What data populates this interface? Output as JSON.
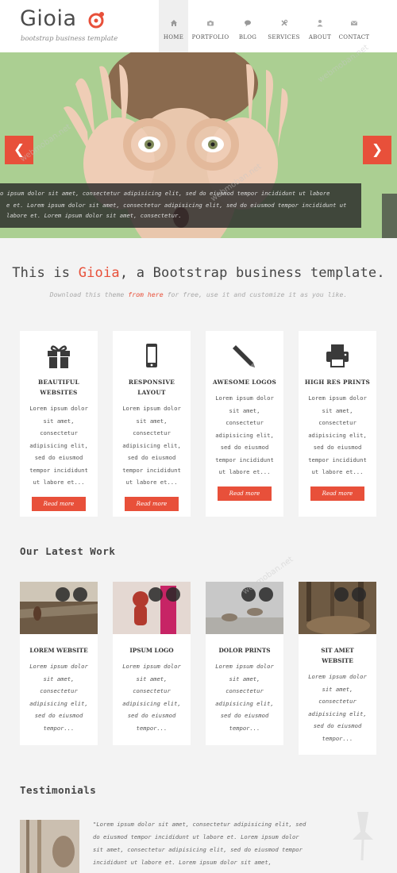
{
  "brand": {
    "name": "Gioia",
    "tagline": "bootstrap business template"
  },
  "nav": {
    "items": [
      {
        "label": "HOME",
        "icon": "home-icon"
      },
      {
        "label": "PORTFOLIO",
        "icon": "camera-icon"
      },
      {
        "label": "BLOG",
        "icon": "comment-icon"
      },
      {
        "label": "SERVICES",
        "icon": "wrench-icon"
      },
      {
        "label": "ABOUT",
        "icon": "user-icon"
      },
      {
        "label": "CONTACT",
        "icon": "envelope-icon"
      }
    ],
    "active": "HOME"
  },
  "hero": {
    "caption_lines": [
      "o ipsum dolor sit amet, consectetur adipisicing elit, sed do eiusmod tempor incididunt ut labore",
      "e et. Lorem ipsum dolor sit amet, consectetur adipisicing elit, sed do eiusmod tempor incididunt ut",
      "labore et. Lorem ipsum dolor sit amet, consectetur."
    ],
    "prev_icon": "chevron-left-icon",
    "next_icon": "chevron-right-icon"
  },
  "intro": {
    "title_pre": "This is ",
    "title_brand": "Gioia",
    "title_post": ", a Bootstrap business template.",
    "sub_pre": "Download this theme ",
    "sub_link": "from here",
    "sub_post": " for free, use it and customize it as you like."
  },
  "features": [
    {
      "icon": "gift-icon",
      "title_lines": [
        "BEAUTIFUL",
        "WEBSITES"
      ],
      "text_lines": [
        "Lorem ipsum dolor",
        "sit amet,",
        "consectetur",
        "adipisicing elit,",
        "sed do eiusmod",
        "tempor incididunt",
        "ut labore et..."
      ],
      "button": "Read more"
    },
    {
      "icon": "mobile-icon",
      "title_lines": [
        "RESPONSIVE",
        "LAYOUT"
      ],
      "text_lines": [
        "Lorem ipsum dolor",
        "sit amet,",
        "consectetur",
        "adipisicing elit,",
        "sed do eiusmod",
        "tempor incididunt",
        "ut labore et..."
      ],
      "button": "Read more"
    },
    {
      "icon": "pencil-icon",
      "title_lines": [
        "AWESOME LOGOS"
      ],
      "text_lines": [
        "Lorem ipsum dolor",
        "sit amet,",
        "consectetur",
        "adipisicing elit,",
        "sed do eiusmod",
        "tempor incididunt",
        "ut labore et..."
      ],
      "button": "Read more"
    },
    {
      "icon": "print-icon",
      "title_lines": [
        "HIGH RES PRINTS"
      ],
      "text_lines": [
        "Lorem ipsum dolor",
        "sit amet,",
        "consectetur",
        "adipisicing elit,",
        "sed do eiusmod",
        "tempor incididunt",
        "ut labore et..."
      ],
      "button": "Read more"
    }
  ],
  "latest_work": {
    "heading": "Our Latest Work",
    "items": [
      {
        "title_lines": [
          "LOREM WEBSITE"
        ],
        "text_lines": [
          "Lorem ipsum dolor",
          "sit amet,",
          "consectetur",
          "adipisicing elit,",
          "sed do eiusmod",
          "tempor..."
        ]
      },
      {
        "title_lines": [
          "IPSUM LOGO"
        ],
        "text_lines": [
          "Lorem ipsum dolor",
          "sit amet,",
          "consectetur",
          "adipisicing elit,",
          "sed do eiusmod",
          "tempor..."
        ]
      },
      {
        "title_lines": [
          "DOLOR PRINTS"
        ],
        "text_lines": [
          "Lorem ipsum dolor",
          "sit amet,",
          "consectetur",
          "adipisicing elit,",
          "sed do eiusmod",
          "tempor..."
        ]
      },
      {
        "title_lines": [
          "SIT AMET",
          "WEBSITE"
        ],
        "text_lines": [
          "Lorem ipsum dolor",
          "sit amet,",
          "consectetur",
          "adipisicing elit,",
          "sed do eiusmod",
          "tempor..."
        ]
      }
    ]
  },
  "testimonials": {
    "heading": "Testimonials",
    "text_lines": [
      "\"Lorem ipsum dolor sit amet, consectetur adipisicing elit, sed",
      "do eiusmod tempor incididunt ut labore et. Lorem ipsum dolor",
      "sit amet, consectetur adipisicing elit, sed do eiusmod tempor",
      "incididunt ut labore et. Lorem ipsum dolor sit amet,"
    ]
  },
  "watermark": "webmoban.net",
  "colors": {
    "accent": "#e8503a",
    "hero_bg": "#a8cf8e",
    "card_bg": "#ffffff",
    "page_bg": "#f3f3f3"
  }
}
